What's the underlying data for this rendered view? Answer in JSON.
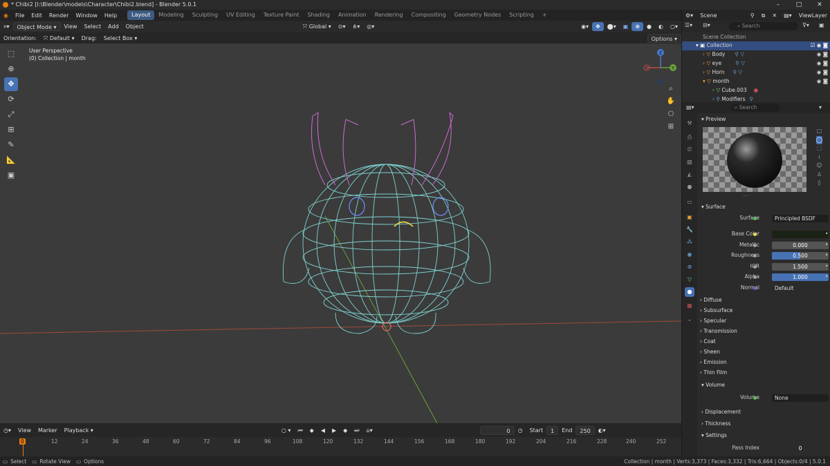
{
  "window": {
    "title": "* Chibi2 [I:\\Blender\\models\\Character\\Chibi2.blend] - Blender 5.0.1"
  },
  "menu": [
    "File",
    "Edit",
    "Render",
    "Window",
    "Help"
  ],
  "workspaces": [
    "Layout",
    "Modeling",
    "Sculpting",
    "UV Editing",
    "Texture Paint",
    "Shading",
    "Animation",
    "Rendering",
    "Compositing",
    "Geometry Nodes",
    "Scripting"
  ],
  "header": {
    "mode": "Object Mode",
    "view": "View",
    "select": "Select",
    "add": "Add",
    "object": "Object",
    "transform": "Global",
    "options": "Options"
  },
  "header2": {
    "orientation_label": "Orientation:",
    "orientation": "Default",
    "drag_label": "Drag:",
    "drag": "Select Box"
  },
  "viewport": {
    "perspective": "User Perspective",
    "collection": "(0) Collection | month"
  },
  "gizmo": {
    "x": "X",
    "y": "Y",
    "z": "Z"
  },
  "timeline": {
    "view": "View",
    "marker": "Marker",
    "playback": "Playback",
    "current": "0",
    "start_label": "Start",
    "start": "1",
    "end_label": "End",
    "end": "250",
    "ticks": [
      "0",
      "12",
      "24",
      "36",
      "48",
      "60",
      "72",
      "84",
      "96",
      "108",
      "120",
      "132",
      "144",
      "156",
      "168",
      "180",
      "192",
      "204",
      "216",
      "228",
      "240",
      "252"
    ]
  },
  "status": {
    "select": "Select",
    "rotate": "Rotate View",
    "options": "Options",
    "info": "Collection | month | Verts:3,373 | Faces:3,332 | Tris:6,664 | Objects:0/4 | 5.0.1"
  },
  "outliner": {
    "scene": "Scene",
    "viewlayer": "ViewLayer",
    "search": "Search",
    "root": "Scene Collection",
    "rows": [
      {
        "label": "Collection"
      },
      {
        "label": "Body"
      },
      {
        "label": "eye"
      },
      {
        "label": "Horn"
      },
      {
        "label": "month"
      },
      {
        "label": "Cube.003"
      },
      {
        "label": "Modifiers"
      }
    ]
  },
  "properties": {
    "search": "Search",
    "preview": "Preview",
    "surface_section": "Surface",
    "surface_label": "Surface",
    "surface_value": "Principled BSDF",
    "fields": [
      {
        "label": "Base Color",
        "value": ""
      },
      {
        "label": "Metallic",
        "value": "0.000"
      },
      {
        "label": "Roughness",
        "value": "0.500"
      },
      {
        "label": "IOR",
        "value": "1.500"
      },
      {
        "label": "Alpha",
        "value": "1.000"
      },
      {
        "label": "Normal",
        "value": "Default"
      }
    ],
    "subsections": [
      "Diffuse",
      "Subsurface",
      "Specular",
      "Transmission",
      "Coat",
      "Sheen",
      "Emission",
      "Thin Film"
    ],
    "volume_section": "Volume",
    "volume_label": "Volume",
    "volume_value": "None",
    "after": [
      "Displacement",
      "Thickness"
    ],
    "settings": "Settings",
    "pass_index_label": "Pass Index",
    "pass_index": "0"
  },
  "colors": {
    "accent": "#4772b3",
    "wire": "#7fd3d1",
    "horn": "#d16ad6",
    "eye": "#6f8fff",
    "mouth": "#e6d84a"
  }
}
